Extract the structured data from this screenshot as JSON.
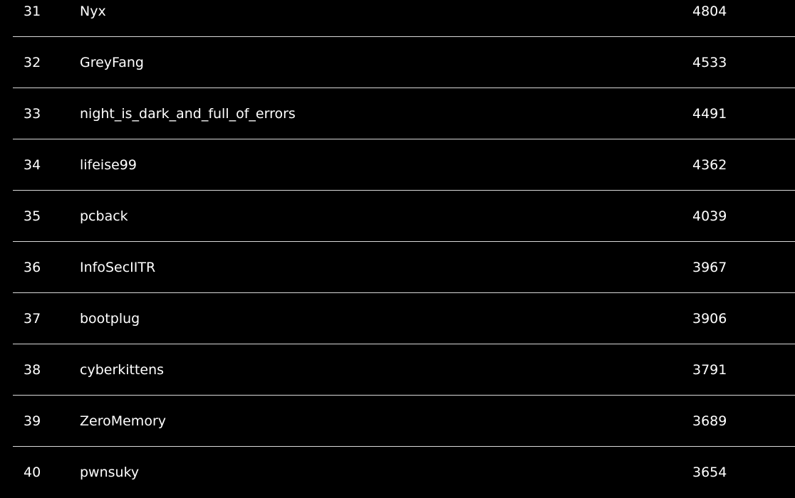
{
  "scoreboard": {
    "rows": [
      {
        "rank": "31",
        "team": "Nyx",
        "score": "4804"
      },
      {
        "rank": "32",
        "team": "GreyFang",
        "score": "4533"
      },
      {
        "rank": "33",
        "team": "night_is_dark_and_full_of_errors",
        "score": "4491"
      },
      {
        "rank": "34",
        "team": "lifeise99",
        "score": "4362"
      },
      {
        "rank": "35",
        "team": "pcback",
        "score": "4039"
      },
      {
        "rank": "36",
        "team": "InfoSecIITR",
        "score": "3967"
      },
      {
        "rank": "37",
        "team": "bootplug",
        "score": "3906"
      },
      {
        "rank": "38",
        "team": "cyberkittens",
        "score": "3791"
      },
      {
        "rank": "39",
        "team": "ZeroMemory",
        "score": "3689"
      },
      {
        "rank": "40",
        "team": "pwnsuky",
        "score": "3654"
      }
    ]
  }
}
